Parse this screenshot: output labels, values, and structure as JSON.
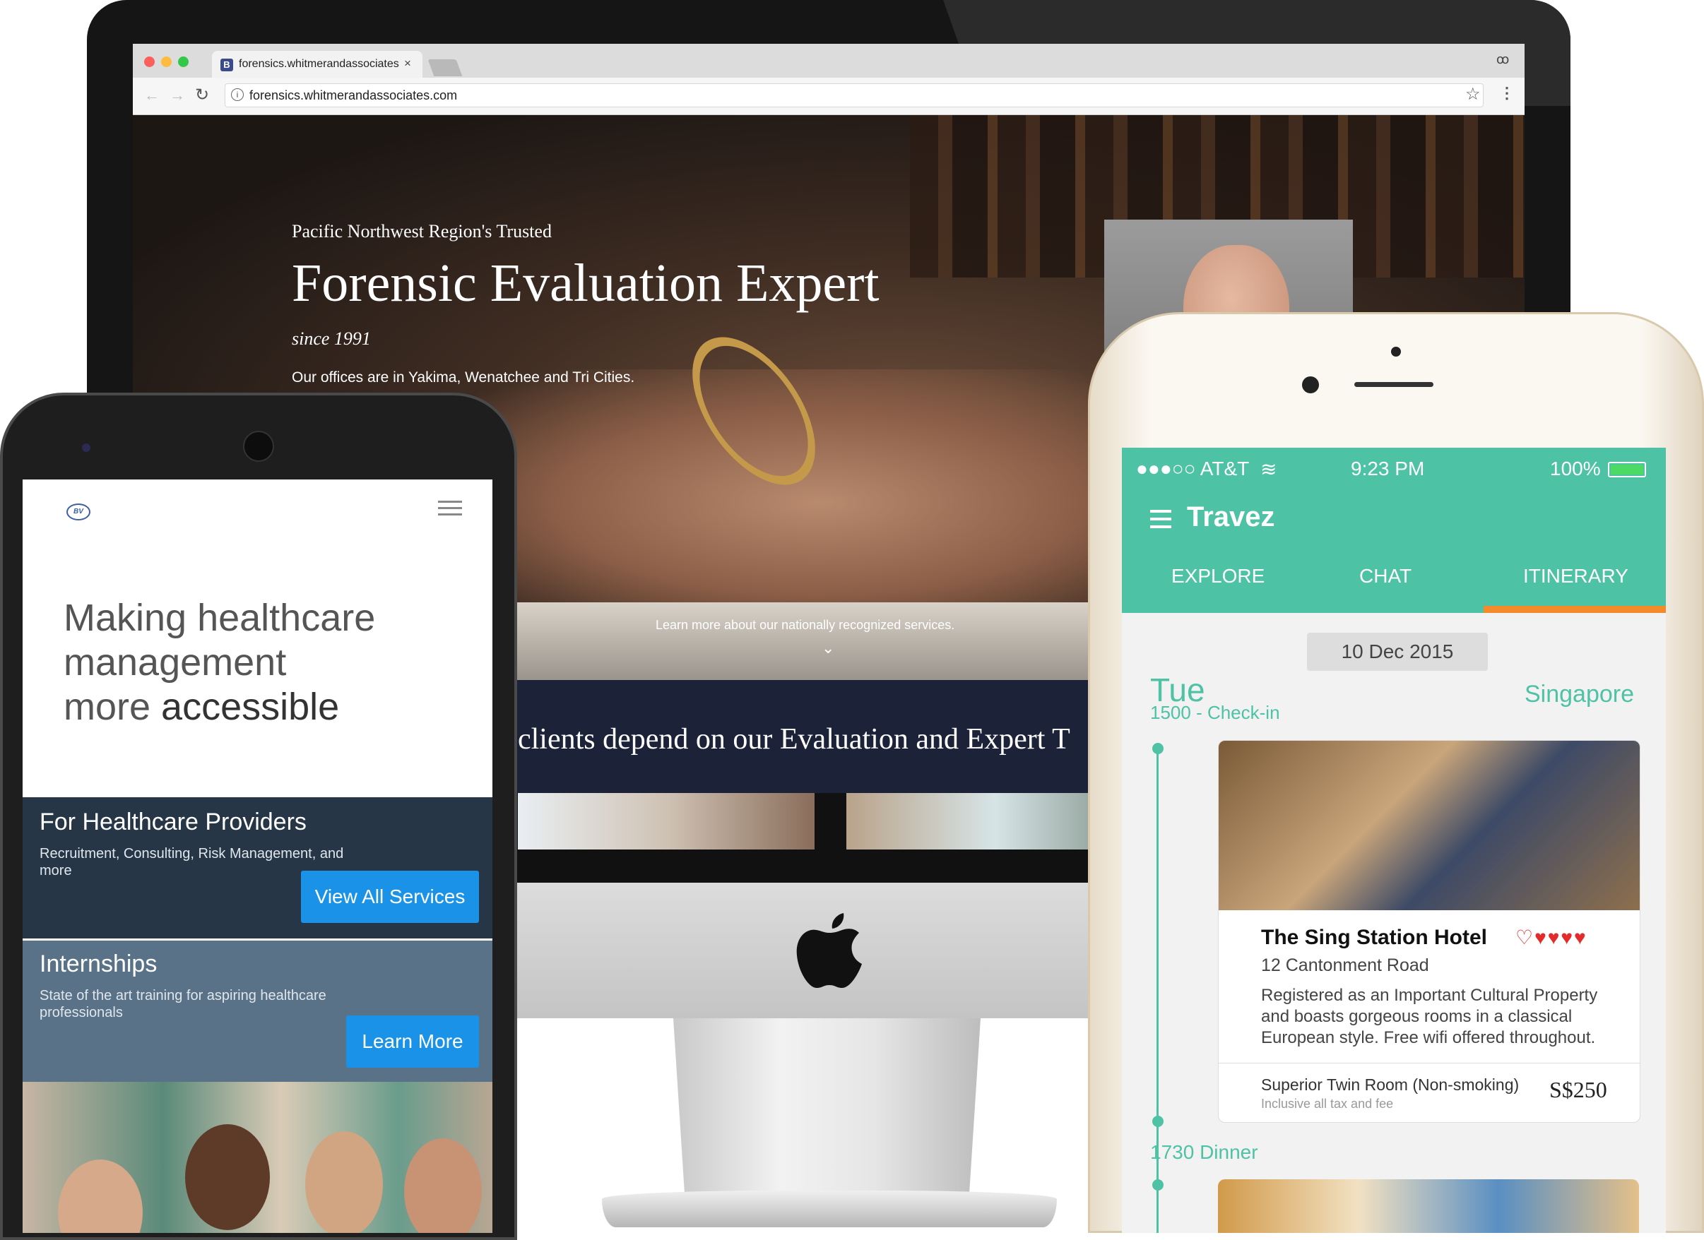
{
  "desktop": {
    "tab_title": "forensics.whitmerandassociates.com",
    "tab_favicon": "B",
    "tab_close": "×",
    "url": "forensics.whitmerandassociates.com",
    "nav_back": "←",
    "nav_forward": "→",
    "reload": "↻",
    "star": "☆",
    "menu": "⋮",
    "incognito": "ꝏ",
    "hero": {
      "kicker": "Pacific Northwest Region's Trusted",
      "title": "Forensic Evaluation Expert",
      "since": "since 1991",
      "offices": "Our offices are in Yakima, Wenatchee and Tri Cities.",
      "learn_more": "Learn more about our nationally recognized services.",
      "chevron": "⌄"
    },
    "banner_text": "clients depend on our Evaluation and Expert T"
  },
  "android": {
    "headline_line1": "Making healthcare",
    "headline_line2": "management",
    "headline_line3a": "more ",
    "headline_line3b": "accessible",
    "providers": {
      "title": "For Healthcare Providers",
      "desc": "Recruitment, Consulting, Risk Management, and more",
      "button": "View All Services"
    },
    "internships": {
      "title": "Internships",
      "desc": "State of the art training for aspiring healthcare professionals",
      "button": "Learn More"
    }
  },
  "iphone": {
    "carrier": "●●●○○ AT&T",
    "wifi": "≋",
    "time": "9:23 PM",
    "battery": "100%",
    "app_title": "Travez",
    "tabs": [
      "EXPLORE",
      "CHAT",
      "ITINERARY"
    ],
    "active_tab": "ITINERARY",
    "date": "10 Dec 2015",
    "day": "Tue",
    "checkin": "1500 - Check-in",
    "city": "Singapore",
    "hotel": {
      "name": "The Sing Station Hotel",
      "hearts": "♡♥♥♥♥",
      "address": "12 Cantonment Road",
      "description": "Registered as an Important Cultural Property and boasts gorgeous rooms in a classical European style. Free wifi offered throughout.",
      "room": "Superior Twin Room (Non-smoking)",
      "tax_note": "Inclusive all tax and fee",
      "price": "S$250"
    },
    "next_event": "1730 Dinner"
  },
  "colors": {
    "travez_teal": "#4ec2a5",
    "itinerary_underline": "#f58a2a",
    "primary_button_blue": "#1992e8",
    "banner_navy": "#1c2238"
  }
}
